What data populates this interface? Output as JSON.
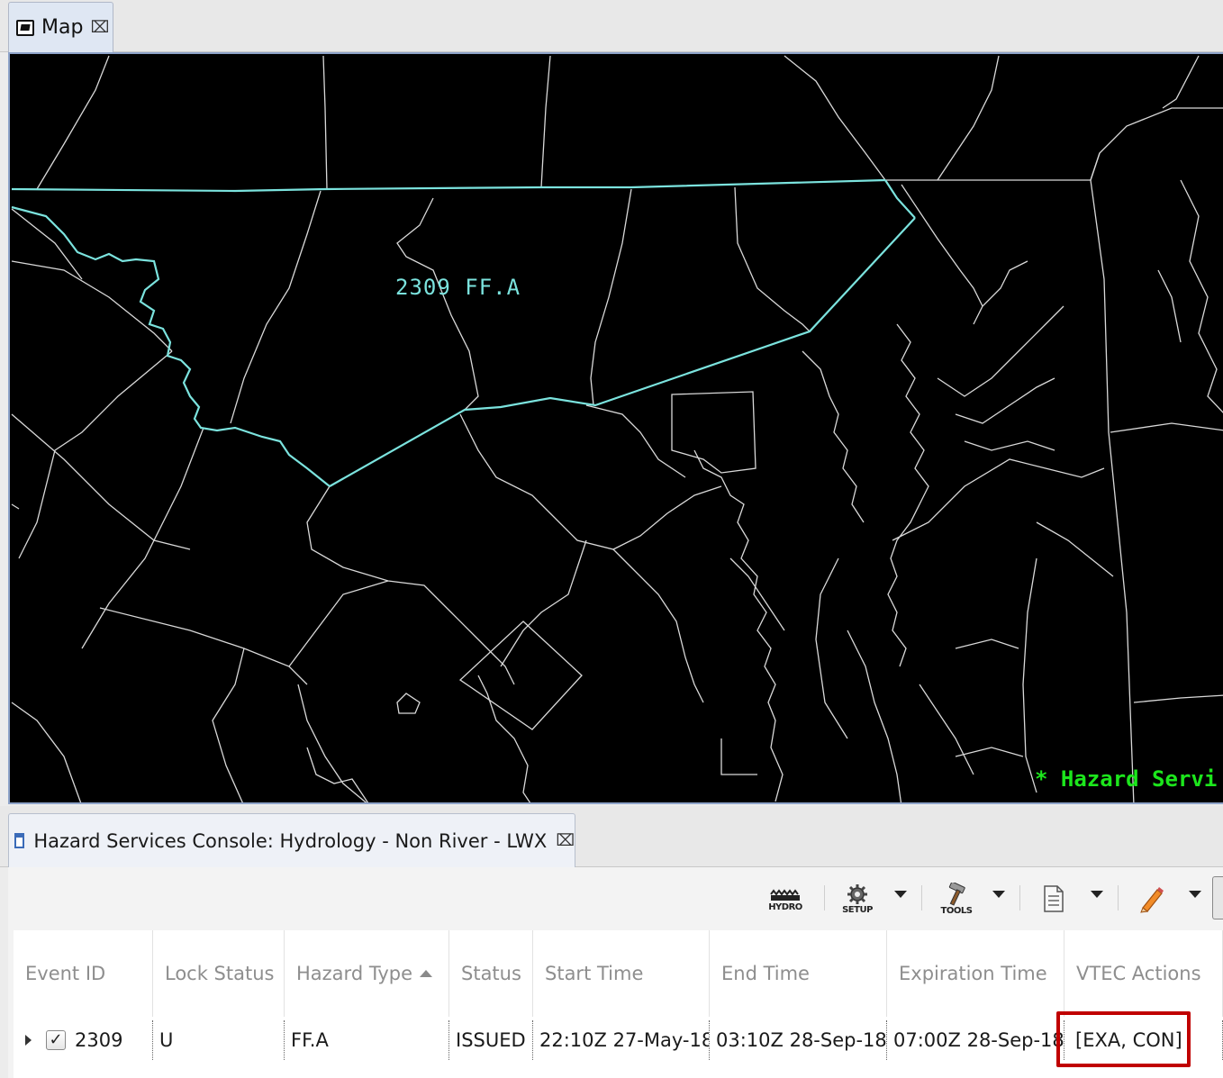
{
  "map_view": {
    "tab_label": "Map",
    "hazard_label": "2309 FF.A",
    "status_text": "* Hazard Servi",
    "colors": {
      "background": "#000000",
      "county_lines": "#d9d9d9",
      "hazard_outline": "#7be3de",
      "status_text": "#1ce61c"
    }
  },
  "console": {
    "tab_label": "Hazard Services Console: Hydrology - Non River - LWX",
    "toolbar": {
      "hydro_label": "HYDRO",
      "setup_label": "SETUP",
      "tools_label": "TOOLS"
    },
    "table": {
      "columns": [
        "Event ID",
        "Lock Status",
        "Hazard Type",
        "Status",
        "Start Time",
        "End Time",
        "Expiration Time",
        "VTEC Actions"
      ],
      "sorted_column": "Hazard Type",
      "rows": [
        {
          "checked": true,
          "event_id": "2309",
          "lock_status": "U",
          "hazard_type": "FF.A",
          "status": "ISSUED",
          "start_time": "22:10Z 27-May-18",
          "end_time": "03:10Z 28-Sep-18",
          "expiration_time": "07:00Z 28-Sep-18",
          "vtec_actions": "[EXA, CON]"
        }
      ]
    },
    "highlight_color": "#c00000"
  }
}
